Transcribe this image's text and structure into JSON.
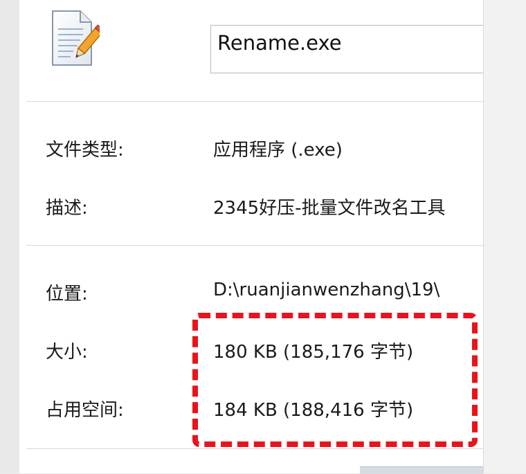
{
  "file": {
    "name": "Rename.exe",
    "icon": "document-pencil-icon"
  },
  "properties": [
    {
      "key": "type",
      "label": "文件类型:",
      "value": "应用程序 (.exe)"
    },
    {
      "key": "description",
      "label": "描述:",
      "value": "2345好压-批量文件改名工具"
    },
    {
      "key": "location",
      "label": "位置:",
      "value": "D:\\ruanjianwenzhang\\19\\"
    },
    {
      "key": "size",
      "label": "大小:",
      "value": "180 KB (185,176 字节)"
    },
    {
      "key": "size_on_disk",
      "label": "占用空间:",
      "value": "184 KB (188,416 字节)"
    }
  ],
  "colors": {
    "highlight": "#e8141c"
  }
}
